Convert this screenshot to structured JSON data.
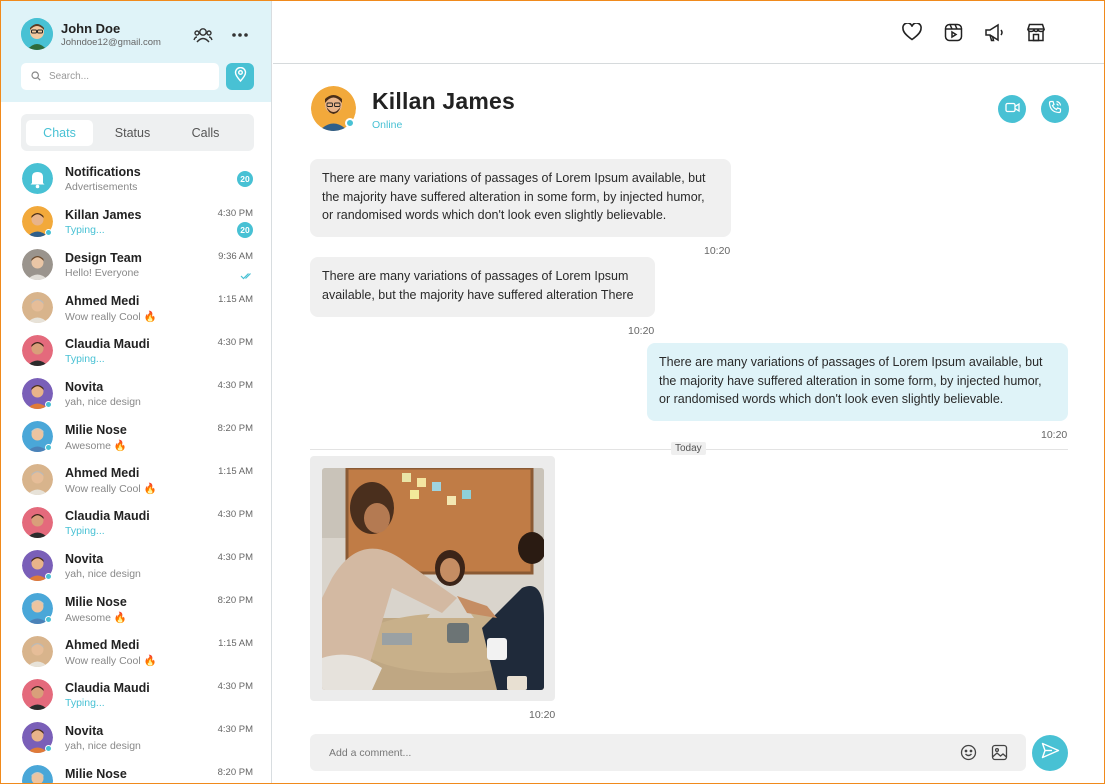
{
  "colors": {
    "accent": "#48c1d4",
    "sidebar_header": "#dff3f8",
    "frame_border": "#f08a1c"
  },
  "profile": {
    "name": "John Doe",
    "email": "Johndoe12@gmail.com"
  },
  "search": {
    "placeholder": "Search..."
  },
  "tabs": [
    {
      "label": "Chats",
      "active": true
    },
    {
      "label": "Status",
      "active": false
    },
    {
      "label": "Calls",
      "active": false
    }
  ],
  "chats": [
    {
      "name": "Notifications",
      "sub": "Advertisements",
      "time": "",
      "badge": "20",
      "typing": false,
      "online": false,
      "avatar": "bell"
    },
    {
      "name": "Killan James",
      "sub": "Typing...",
      "time": "4:30 PM",
      "badge": "20",
      "typing": true,
      "online": true,
      "avatar": "orange"
    },
    {
      "name": "Design Team",
      "sub": "Hello! Everyone",
      "time": "9:36 AM",
      "badge": "",
      "typing": false,
      "online": false,
      "avatar": "grey",
      "read": true
    },
    {
      "name": "Ahmed Medi",
      "sub": "Wow really Cool 🔥",
      "time": "1:15 AM",
      "badge": "",
      "typing": false,
      "online": false,
      "avatar": "beige"
    },
    {
      "name": "Claudia Maudi",
      "sub": "Typing...",
      "time": "4:30 PM",
      "badge": "",
      "typing": true,
      "online": false,
      "avatar": "pink"
    },
    {
      "name": "Novita",
      "sub": "yah, nice design",
      "time": "4:30 PM",
      "badge": "",
      "typing": false,
      "online": true,
      "avatar": "purple"
    },
    {
      "name": "Milie Nose",
      "sub": "Awesome 🔥",
      "time": "8:20 PM",
      "badge": "",
      "typing": false,
      "online": true,
      "avatar": "blue"
    },
    {
      "name": "Ahmed Medi",
      "sub": "Wow really Cool 🔥",
      "time": "1:15 AM",
      "badge": "",
      "typing": false,
      "online": false,
      "avatar": "beige"
    },
    {
      "name": "Claudia Maudi",
      "sub": "Typing...",
      "time": "4:30 PM",
      "badge": "",
      "typing": true,
      "online": false,
      "avatar": "pink"
    },
    {
      "name": "Novita",
      "sub": "yah, nice design",
      "time": "4:30 PM",
      "badge": "",
      "typing": false,
      "online": true,
      "avatar": "purple"
    },
    {
      "name": "Milie Nose",
      "sub": "Awesome 🔥",
      "time": "8:20 PM",
      "badge": "",
      "typing": false,
      "online": true,
      "avatar": "blue"
    },
    {
      "name": "Ahmed Medi",
      "sub": "Wow really Cool 🔥",
      "time": "1:15 AM",
      "badge": "",
      "typing": false,
      "online": false,
      "avatar": "beige"
    },
    {
      "name": "Claudia Maudi",
      "sub": "Typing...",
      "time": "4:30 PM",
      "badge": "",
      "typing": true,
      "online": false,
      "avatar": "pink"
    },
    {
      "name": "Novita",
      "sub": "yah, nice design",
      "time": "4:30 PM",
      "badge": "",
      "typing": false,
      "online": true,
      "avatar": "purple"
    },
    {
      "name": "Milie Nose",
      "sub": "",
      "time": "8:20 PM",
      "badge": "",
      "typing": false,
      "online": true,
      "avatar": "blue"
    }
  ],
  "top_icons": [
    "heart-icon",
    "reels-icon",
    "megaphone-icon",
    "store-icon"
  ],
  "contact": {
    "name": "Killan James",
    "status": "Online"
  },
  "messages": [
    {
      "text": "There are many variations of passages of Lorem Ipsum available, but the majority have suffered alteration in some form, by injected humor, or randomised words which don't look even slightly believable.",
      "time": "10:20",
      "direction": "in"
    },
    {
      "text": "There are many variations of passages of Lorem Ipsum available, but the majority have suffered alteration There",
      "time": "10:20",
      "direction": "in"
    },
    {
      "text": "There are many variations of passages of Lorem Ipsum available, but the majority have suffered alteration in some form, by injected humor, or randomised words which don't look even slightly believable.",
      "time": "10:20",
      "direction": "out"
    }
  ],
  "day_divider": "Today",
  "image_message": {
    "time": "10:20"
  },
  "composer": {
    "placeholder": "Add a comment..."
  }
}
